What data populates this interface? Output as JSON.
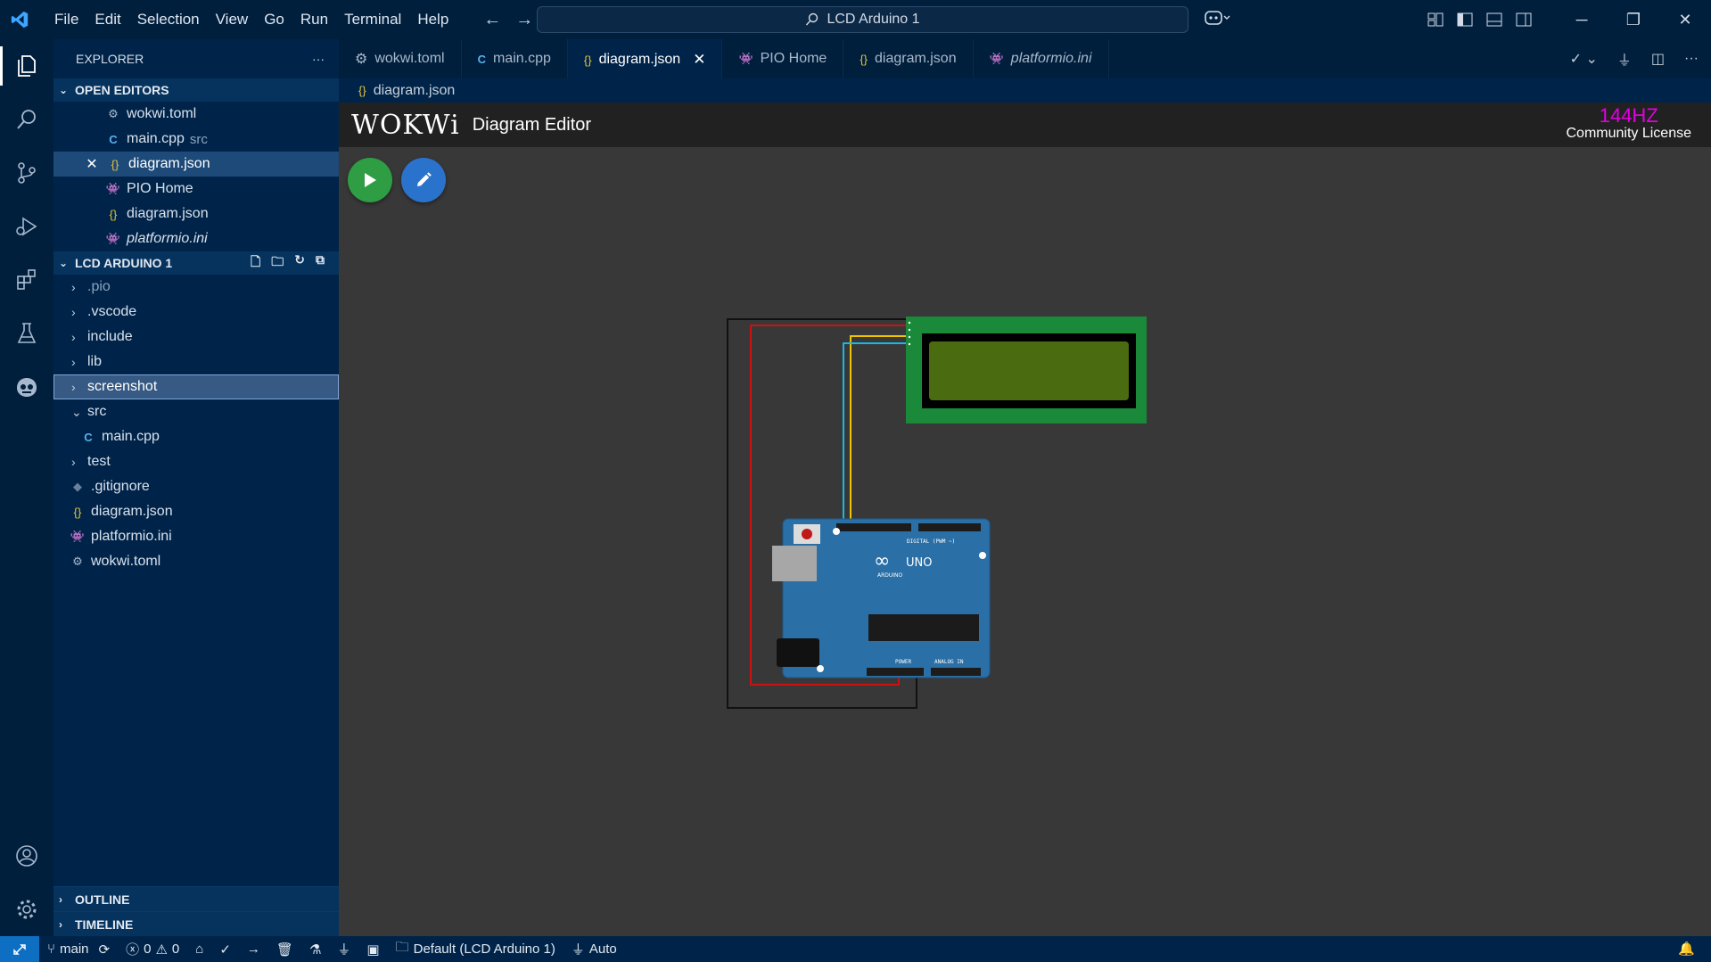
{
  "titlebar": {
    "menu": [
      "File",
      "Edit",
      "Selection",
      "View",
      "Go",
      "Run",
      "Terminal",
      "Help"
    ],
    "search_text": "LCD Arduino 1"
  },
  "sidebar": {
    "title": "EXPLORER",
    "open_editors_label": "OPEN EDITORS",
    "open_editors": [
      {
        "name": "wokwi.toml",
        "icon": "gear-icon"
      },
      {
        "name": "main.cpp",
        "desc": "src",
        "icon": "cpp-icon"
      },
      {
        "name": "diagram.json",
        "icon": "json-icon",
        "selected": true
      },
      {
        "name": "PIO Home",
        "icon": "platformio-icon"
      },
      {
        "name": "diagram.json",
        "icon": "json-icon"
      },
      {
        "name": "platformio.ini",
        "icon": "platformio-icon",
        "italic": true
      }
    ],
    "project_label": "LCD ARDUINO 1",
    "tree": [
      {
        "name": ".pio",
        "type": "folder"
      },
      {
        "name": ".vscode",
        "type": "folder"
      },
      {
        "name": "include",
        "type": "folder"
      },
      {
        "name": "lib",
        "type": "folder"
      },
      {
        "name": "screenshot",
        "type": "folder",
        "focused": true
      },
      {
        "name": "src",
        "type": "folder-open"
      },
      {
        "name": "main.cpp",
        "type": "cpp-file"
      },
      {
        "name": "test",
        "type": "folder"
      },
      {
        "name": ".gitignore",
        "type": "git-file"
      },
      {
        "name": "diagram.json",
        "type": "json-file"
      },
      {
        "name": "platformio.ini",
        "type": "pio-file"
      },
      {
        "name": "wokwi.toml",
        "type": "toml-file"
      }
    ],
    "outline_label": "OUTLINE",
    "timeline_label": "TIMELINE"
  },
  "tabs": [
    {
      "label": "wokwi.toml",
      "icon": "gear-icon"
    },
    {
      "label": "main.cpp",
      "icon": "cpp-icon"
    },
    {
      "label": "diagram.json",
      "icon": "json-icon",
      "active": true
    },
    {
      "label": "PIO Home",
      "icon": "platformio-icon"
    },
    {
      "label": "diagram.json",
      "icon": "json-icon"
    },
    {
      "label": "platformio.ini",
      "icon": "platformio-icon",
      "italic": true
    }
  ],
  "breadcrumb": "diagram.json",
  "wokwi": {
    "logo": "WOKWi",
    "title": "Diagram Editor",
    "hz": "144HZ",
    "license": "Community License",
    "board_label": "UNO",
    "board_brand": "ARDUINO",
    "digital_label": "DIGITAL (PWM ~)",
    "power_label": "POWER",
    "analog_label": "ANALOG IN"
  },
  "statusbar": {
    "branch": "main",
    "errors": "0",
    "warnings": "0",
    "env": "Default (LCD Arduino 1)",
    "port": "Auto"
  },
  "colors": {
    "accent": "#0e6fc2",
    "sidebar_bg": "#002449",
    "hz": "#e100e1",
    "play": "#2e9d44",
    "edit": "#2a73cc"
  }
}
